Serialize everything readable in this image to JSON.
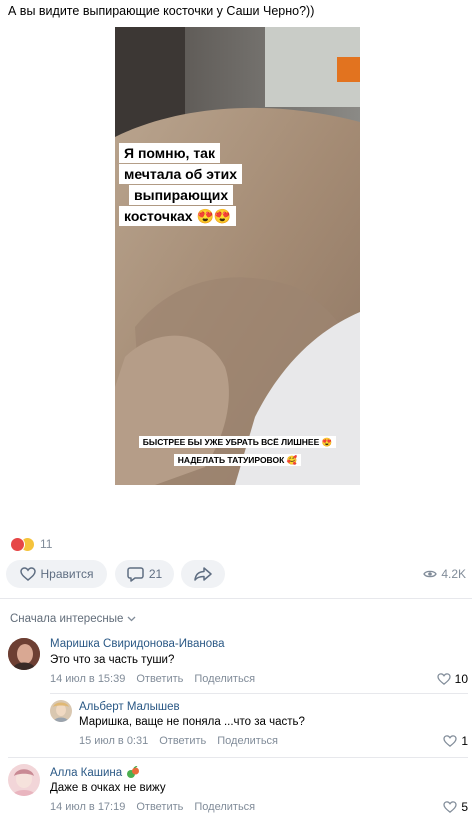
{
  "post": {
    "text": "А вы видите выпирающие косточки у Саши Черно?))",
    "captions": {
      "line1": "Я помню, так",
      "line2": "мечтала об этих",
      "line3": "выпирающих",
      "line4": "косточках 😍😍",
      "bottom_line1": "БЫСТРЕЕ БЫ УЖЕ УБРАТЬ ВСЁ ЛИШНЕЕ 😍",
      "bottom_line2": "НАДЕЛАТЬ ТАТУИРОВОК 🥰"
    },
    "reactions": {
      "count": "11",
      "icons": [
        "heart-reaction",
        "laugh-reaction"
      ]
    },
    "actions": {
      "like_label": "Нравится",
      "comments_count": "21",
      "share_icon": "share-icon"
    },
    "views": "4.2K"
  },
  "comments_header": {
    "sort_label": "Сначала интересные"
  },
  "comments": [
    {
      "author": "Маришка Свиридонова-Иванова",
      "text": "Это что за часть туши?",
      "date": "14 июл в 15:39",
      "reply": "Ответить",
      "share": "Поделиться",
      "likes": "10"
    },
    {
      "author": "Альберт Малышев",
      "text": "Маришка, ваще не поняла ...что за часть?",
      "date": "15 июл в 0:31",
      "reply": "Ответить",
      "share": "Поделиться",
      "likes": "1"
    },
    {
      "author": "Алла Кашина",
      "text": "Даже в очках не вижу",
      "date": "14 июл в 17:19",
      "reply": "Ответить",
      "share": "Поделиться",
      "likes": "5"
    }
  ],
  "colors": {
    "link": "#2a5885",
    "muted": "#818c99",
    "button_bg": "#f0f2f5",
    "heart": "#e64646"
  }
}
